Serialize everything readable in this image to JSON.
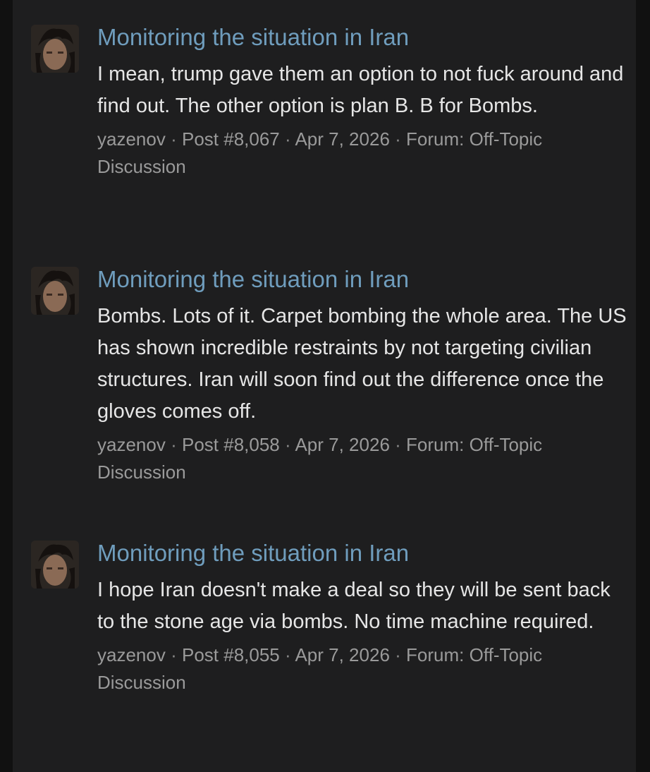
{
  "posts": [
    {
      "title": "Monitoring the situation in Iran",
      "snippet": "I mean, trump gave them an option to not fuck around and find out. The other option is plan B. B for Bombs.",
      "author": "yazenov",
      "post_number": "Post #8,067",
      "date": "Apr 7, 2026",
      "forum": "Forum: Off-Topic Discussion"
    },
    {
      "title": "Monitoring the situation in Iran",
      "snippet": "Bombs. Lots of it. Carpet bombing the whole area. The US has shown incredible restraints by not targeting civilian structures. Iran will soon find out the difference once the gloves comes off.",
      "author": "yazenov",
      "post_number": "Post #8,058",
      "date": "Apr 7, 2026",
      "forum": "Forum: Off-Topic Discussion"
    },
    {
      "title": "Monitoring the situation in Iran",
      "snippet": "I hope Iran doesn't make a deal so they will be sent back to the stone age via bombs. No time machine required.",
      "author": "yazenov",
      "post_number": "Post #8,055",
      "date": "Apr 7, 2026",
      "forum": "Forum: Off-Topic Discussion"
    }
  ],
  "separator": "·",
  "avatar_icon": "user-avatar",
  "colors": {
    "background": "#1e1e1f",
    "title_link": "#6f9dbd",
    "body_text": "#e6e6e6",
    "meta_text": "#9a9a9a"
  }
}
